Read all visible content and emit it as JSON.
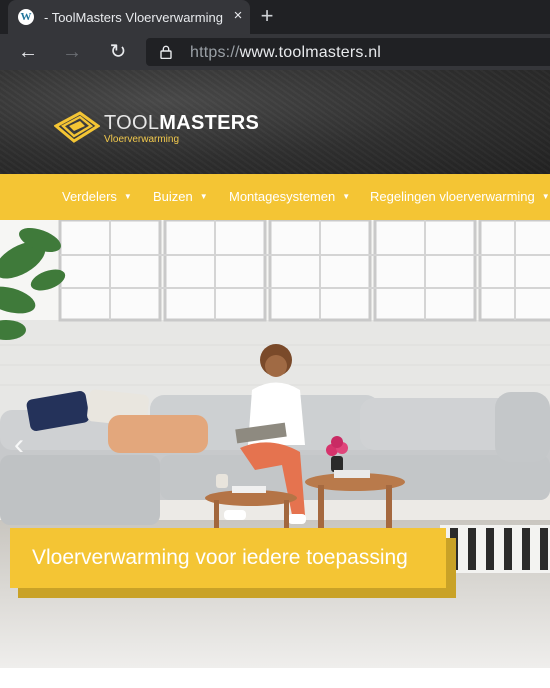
{
  "browser": {
    "tab": {
      "favicon": "wordpress-icon",
      "title": "- ToolMasters Vloerverwarming",
      "close": "×"
    },
    "new_tab": "+",
    "nav": {
      "back": "←",
      "forward": "→",
      "reload": "↻"
    },
    "url": {
      "scheme": "https://",
      "host": "www.toolmasters.nl"
    }
  },
  "site": {
    "logo": {
      "word_thin": "TOOL",
      "word_bold": "MASTERS",
      "tagline": "Vloerverwarming"
    },
    "menu": [
      {
        "label": "Verdelers",
        "caret": "▼"
      },
      {
        "label": "Buizen",
        "caret": "▼"
      },
      {
        "label": "Montagesystemen",
        "caret": "▼"
      },
      {
        "label": "Regelingen vloerverwarming",
        "caret": "▼"
      }
    ],
    "hero": {
      "prev_arrow": "‹",
      "caption": "Vloerverwarming voor iedere toepassing"
    }
  },
  "colors": {
    "accent": "#f4c534",
    "header_bg": "#2f2f2f",
    "chrome_bg": "#35363a"
  }
}
